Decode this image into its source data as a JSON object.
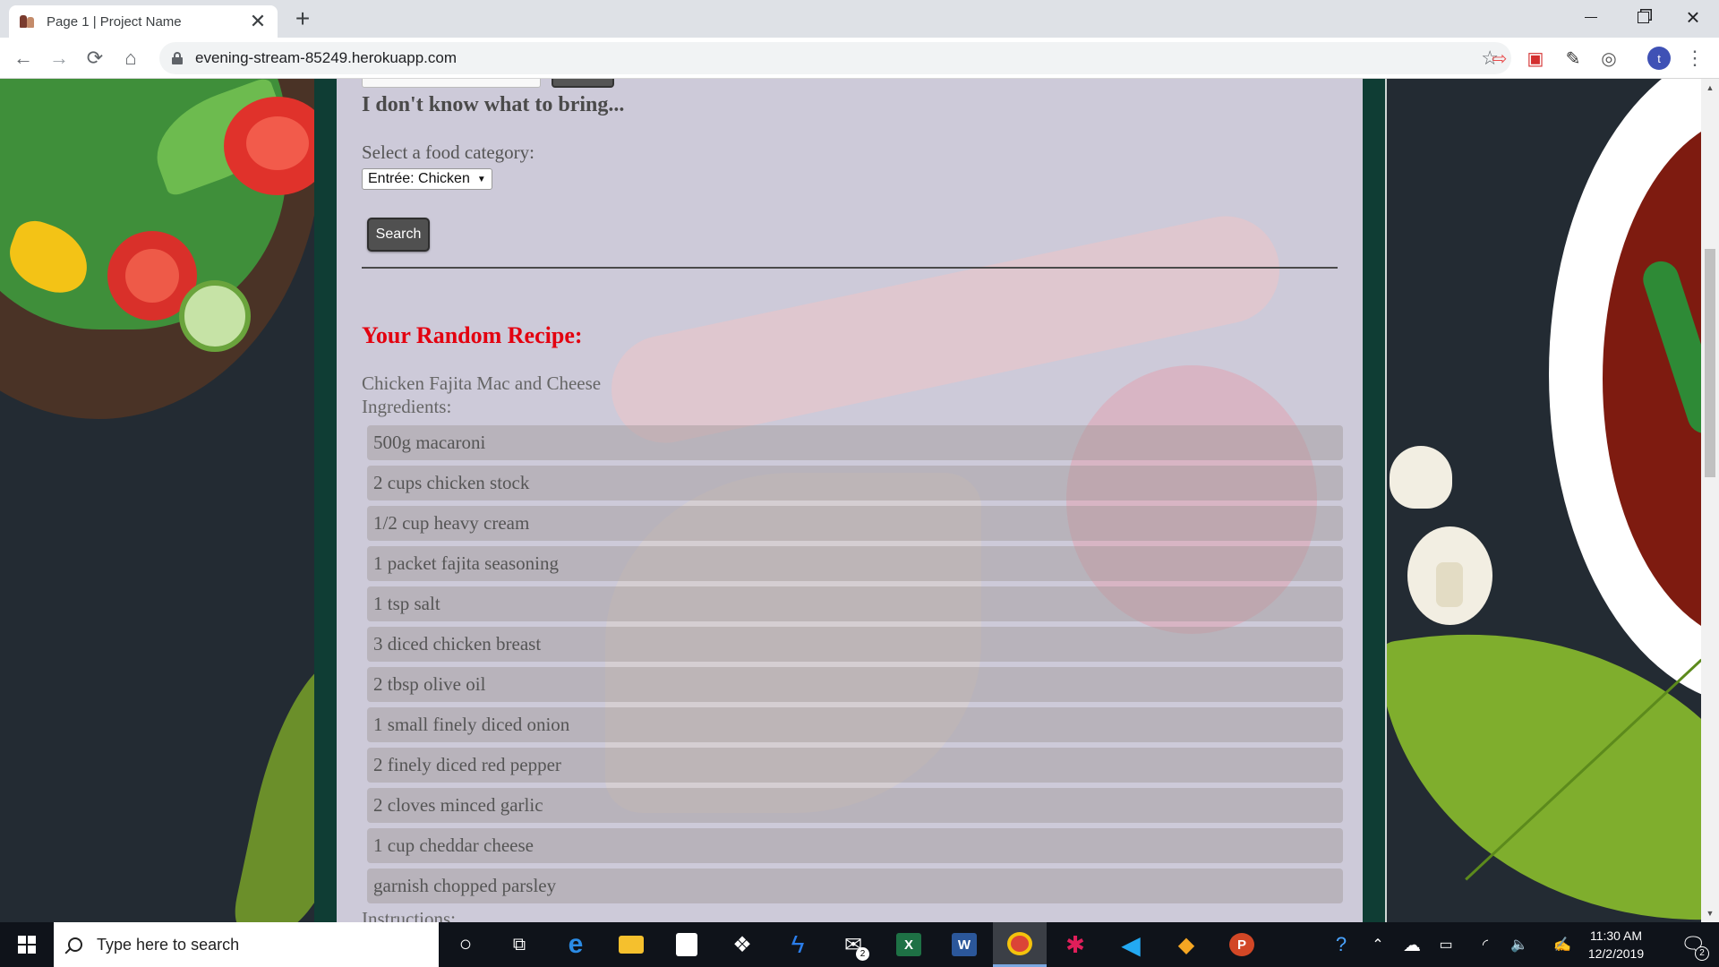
{
  "browser": {
    "tab_title": "Page 1 | Project Name",
    "tab_close": "✕",
    "new_tab": "+",
    "url": "evening-stream-85249.herokuapp.com",
    "profile_initial": "t"
  },
  "page": {
    "question_heading": "I don't know what to bring...",
    "select_label": "Select a food category:",
    "selected_category": "Entrée: Chicken",
    "search_button": "Search",
    "recipe_heading": "Your Random Recipe:",
    "recipe_name": "Chicken Fajita Mac and Cheese",
    "ingredients_label": "Ingredients:",
    "ingredients": [
      "500g macaroni",
      "2 cups chicken stock",
      "1/2 cup heavy cream",
      "1 packet fajita seasoning",
      "1 tsp salt",
      "3 diced chicken breast",
      "2 tbsp olive oil",
      "1 small finely diced onion",
      "2 finely diced red pepper",
      "2 cloves minced garlic",
      "1 cup cheddar cheese",
      "garnish chopped parsley"
    ],
    "instructions_label": "Instructions:"
  },
  "taskbar": {
    "search_placeholder": "Type here to search",
    "mail_badge": "2",
    "time": "11:30 AM",
    "date": "12/2/2019",
    "notification_count": "2"
  },
  "colors": {
    "recipe_heading": "#e3000f",
    "panel_bg": "#cdcad9",
    "taskbar_bg": "#0f131a"
  }
}
